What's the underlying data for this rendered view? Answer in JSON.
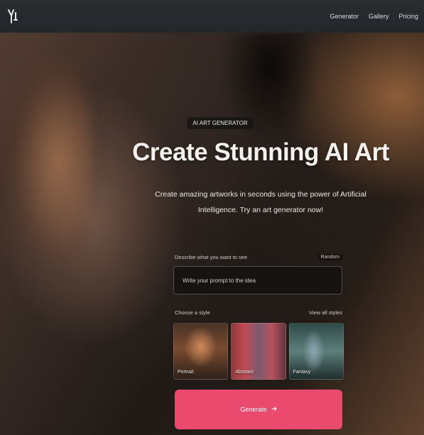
{
  "header": {
    "logo_icon": "brand-logo-icon",
    "nav": [
      "Generator",
      "Gallery",
      "Pricing"
    ]
  },
  "hero": {
    "badge": "AI ART GENERATOR",
    "title": "Create Stunning AI Art",
    "description": "Create amazing artworks in seconds using the power of Artificial Intelligence. Try an art generator now!"
  },
  "prompt": {
    "label": "Describe what you want to see",
    "tag": "Random",
    "placeholder": "Write your prompt to the idea"
  },
  "styles": {
    "label": "Choose a style",
    "link": "View all styles",
    "cards": [
      "Portrait",
      "Abstract",
      "Fantasy"
    ]
  },
  "cta": {
    "label": "Generate",
    "icon": "arrow-right-icon",
    "color": "#e94a6e"
  }
}
